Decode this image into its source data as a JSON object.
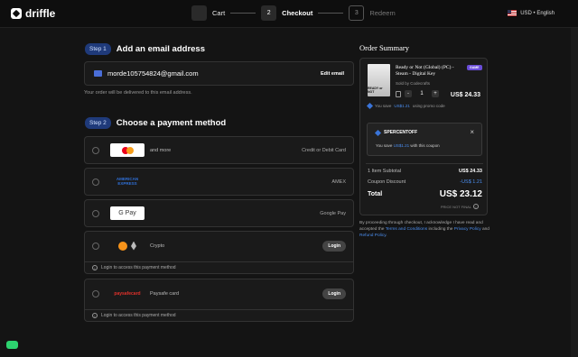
{
  "brand": "driffle",
  "steps": [
    {
      "num": "",
      "label": "Cart"
    },
    {
      "num": "2",
      "label": "Checkout"
    },
    {
      "num": "3",
      "label": "Redeem"
    }
  ],
  "locale": "USD • English",
  "email_section": {
    "pill": "Step 1",
    "title": "Add an email address",
    "email": "morde105754824@gmail.com",
    "edit_label": "Edit email",
    "note": "Your order will be delivered to this email address."
  },
  "payment_section": {
    "pill": "Step 2",
    "title": "Choose a payment method",
    "methods": [
      {
        "logo": "mastercard",
        "text": "and more",
        "right": "Credit or Debit Card"
      },
      {
        "logo": "AMERICAN EXPRESS",
        "text": "",
        "right": "AMEX"
      },
      {
        "logo": "G Pay",
        "text": "",
        "right": "Google Pay"
      },
      {
        "logo": "crypto",
        "text": "Crypto",
        "right": "Login",
        "note": "Login to access this payment method"
      },
      {
        "logo": "paysafecard",
        "text": "Paysafe card",
        "right": "Login",
        "note": "Login to access this payment method"
      }
    ]
  },
  "summary": {
    "title": "Order Summary",
    "product_title": "Ready or Not (Global) (PC) - Steam - Digital Key",
    "thumb_text": "READY or NOT",
    "badge": "GAME",
    "sold_by": "Sold by Codecrafts",
    "qty": "1",
    "price": "US$ 24.33",
    "save_prefix": "You save",
    "save_amount": "US$1.21",
    "save_suffix": "using promo code",
    "promo_code": "SPERCENTOFF",
    "promo_prefix": "You save",
    "promo_amount": "US$1.21",
    "promo_suffix": "with this coupon",
    "subtotal_label": "1 Item Subtotal",
    "subtotal": "US$ 24.33",
    "discount_label": "Coupon Discount",
    "discount": "-US$ 1.21",
    "total_label": "Total",
    "total": "US$ 23.12",
    "price_note": "PRICE NOT FINAL"
  },
  "legal": {
    "text1": "By proceeding through checkout, I acknowledge I have read and accepted the",
    "terms": "Terms and Conditions",
    "text2": "including the",
    "privacy": "Privacy Policy",
    "text3": "and",
    "refund": "Refund Policy",
    "text4": "."
  }
}
